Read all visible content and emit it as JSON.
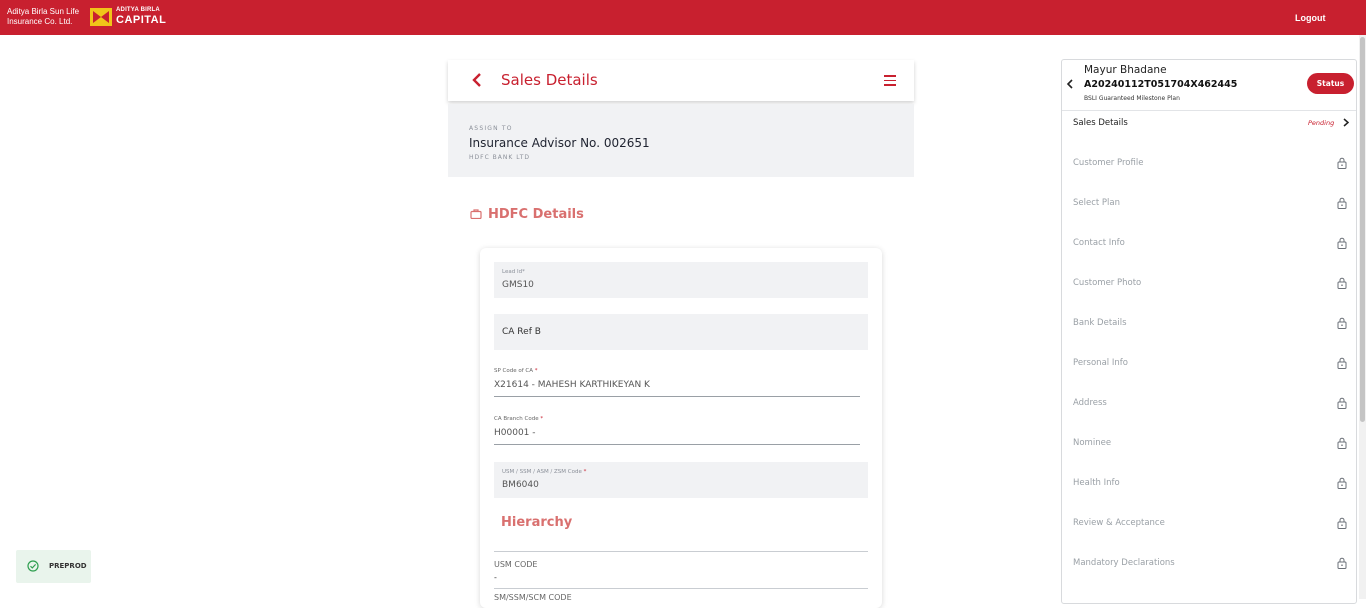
{
  "topbar": {
    "brand_line1": "Aditya Birla Sun Life",
    "brand_line2": "Insurance Co. Ltd.",
    "logo_small": "ADITYA BIRLA",
    "logo_big": "CAPITAL",
    "logout_label": "Logout",
    "color": "#c8202f"
  },
  "header": {
    "title": "Sales Details",
    "back_icon": "chevron-left-icon",
    "menu_icon": "hamburger-menu-icon"
  },
  "assign": {
    "label": "ASSIGN TO",
    "value": "Insurance Advisor No. 002651",
    "sub": "HDFC BANK LTD"
  },
  "section": {
    "title": "HDFC Details",
    "icon": "briefcase-icon"
  },
  "form": {
    "lead_id_label": "Lead Id*",
    "lead_id_value": "GMS10",
    "ca_ref_label": "CA Ref B",
    "sp_code_label": "SP Code of CA",
    "sp_code_value": "X21614 - MAHESH KARTHIKEYAN  K",
    "branch_code_label": "CA Branch Code",
    "branch_code_value": "H00001 -",
    "usm_label": "USM / SSM / ASM / ZSM Code",
    "usm_value": "BM6040",
    "required_mark": "*",
    "hierarchy_title": "Hierarchy",
    "usm_code_label": "USM CODE",
    "usm_code_value": "-",
    "sm_code_label": "SM/SSM/SCM CODE"
  },
  "env_badge": {
    "label": "PREPROD",
    "icon": "check-circle-icon"
  },
  "panel": {
    "name": "Mayur Bhadane",
    "app_id": "A20240112T051704X462445",
    "plan": "BSLI Guaranteed Milestone Plan",
    "status_label": "Status",
    "items": [
      {
        "label": "Sales Details",
        "status": "Pending"
      },
      {
        "label": "Customer Profile"
      },
      {
        "label": "Select Plan"
      },
      {
        "label": "Contact Info"
      },
      {
        "label": "Customer Photo"
      },
      {
        "label": "Bank Details"
      },
      {
        "label": "Personal Info"
      },
      {
        "label": "Address"
      },
      {
        "label": "Nominee"
      },
      {
        "label": "Health Info"
      },
      {
        "label": "Review & Acceptance"
      },
      {
        "label": "Mandatory Declarations"
      }
    ]
  }
}
